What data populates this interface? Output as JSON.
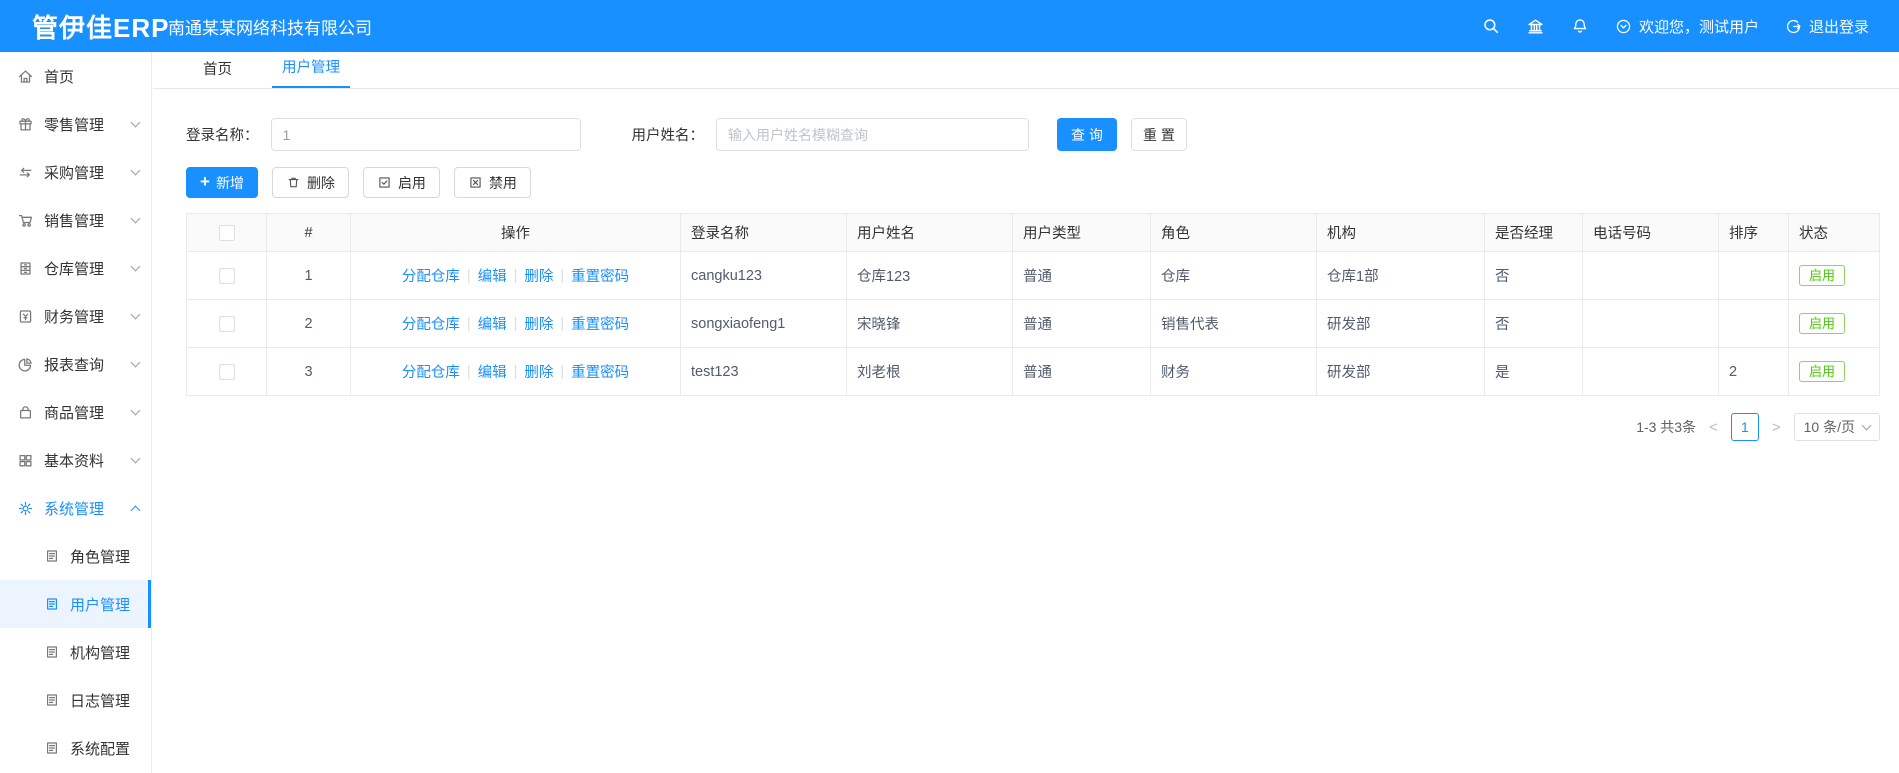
{
  "header": {
    "logo": "管伊佳ERP",
    "company": "南通某某网络科技有限公司",
    "welcome": "欢迎您，测试用户",
    "logout_label": "退出登录"
  },
  "icons": {
    "header": [
      "search-icon",
      "bank-icon",
      "bell-icon",
      "user-dropdown-icon",
      "logout-icon"
    ],
    "pagination_prev": "<",
    "pagination_next": ">",
    "add_plus": "+"
  },
  "colors": {
    "primary": "#1890ff",
    "status_green": "#52c41a",
    "active_sub_bg": "#ecf5ff"
  },
  "sidebar": {
    "items": [
      {
        "label": "首页",
        "icon": "home"
      },
      {
        "label": "零售管理",
        "icon": "gift",
        "arrow": "down"
      },
      {
        "label": "采购管理",
        "icon": "swap",
        "arrow": "down"
      },
      {
        "label": "销售管理",
        "icon": "cart",
        "arrow": "down"
      },
      {
        "label": "仓库管理",
        "icon": "cabinet",
        "arrow": "down"
      },
      {
        "label": "财务管理",
        "icon": "finance",
        "arrow": "down"
      },
      {
        "label": "报表查询",
        "icon": "pie",
        "arrow": "down"
      },
      {
        "label": "商品管理",
        "icon": "bag",
        "arrow": "down"
      },
      {
        "label": "基本资料",
        "icon": "grid",
        "arrow": "down"
      },
      {
        "label": "系统管理",
        "icon": "gear",
        "arrow": "up",
        "active": true
      }
    ],
    "sub_items": [
      {
        "label": "角色管理"
      },
      {
        "label": "用户管理",
        "active": true
      },
      {
        "label": "机构管理"
      },
      {
        "label": "日志管理"
      },
      {
        "label": "系统配置"
      }
    ]
  },
  "tabs": [
    {
      "label": "首页"
    },
    {
      "label": "用户管理",
      "active": true
    }
  ],
  "search": {
    "login_label": "登录名称：",
    "login_value": "1",
    "name_label": "用户姓名：",
    "name_placeholder": "输入用户姓名模糊查询",
    "query_label": "查 询",
    "reset_label": "重 置"
  },
  "toolbar": {
    "add": "新增",
    "delete": "删除",
    "enable": "启用",
    "disable": "禁用"
  },
  "table": {
    "headers": [
      "#",
      "操作",
      "登录名称",
      "用户姓名",
      "用户类型",
      "角色",
      "机构",
      "是否经理",
      "电话号码",
      "排序",
      "状态"
    ],
    "op_links": [
      "分配仓库",
      "编辑",
      "删除",
      "重置密码"
    ],
    "rows": [
      {
        "index": "1",
        "login": "cangku123",
        "name": "仓库123",
        "type": "普通",
        "role": "仓库",
        "org": "仓库1部",
        "manager": "否",
        "phone": "",
        "sort": "",
        "status": "启用"
      },
      {
        "index": "2",
        "login": "songxiaofeng1",
        "name": "宋晓锋",
        "type": "普通",
        "role": "销售代表",
        "org": "研发部",
        "manager": "否",
        "phone": "",
        "sort": "",
        "status": "启用"
      },
      {
        "index": "3",
        "login": "test123",
        "name": "刘老根",
        "type": "普通",
        "role": "财务",
        "org": "研发部",
        "manager": "是",
        "phone": "",
        "sort": "2",
        "status": "启用"
      }
    ]
  },
  "pagination": {
    "total_text": "1-3 共3条",
    "current_page": "1",
    "page_size": "10 条/页"
  }
}
